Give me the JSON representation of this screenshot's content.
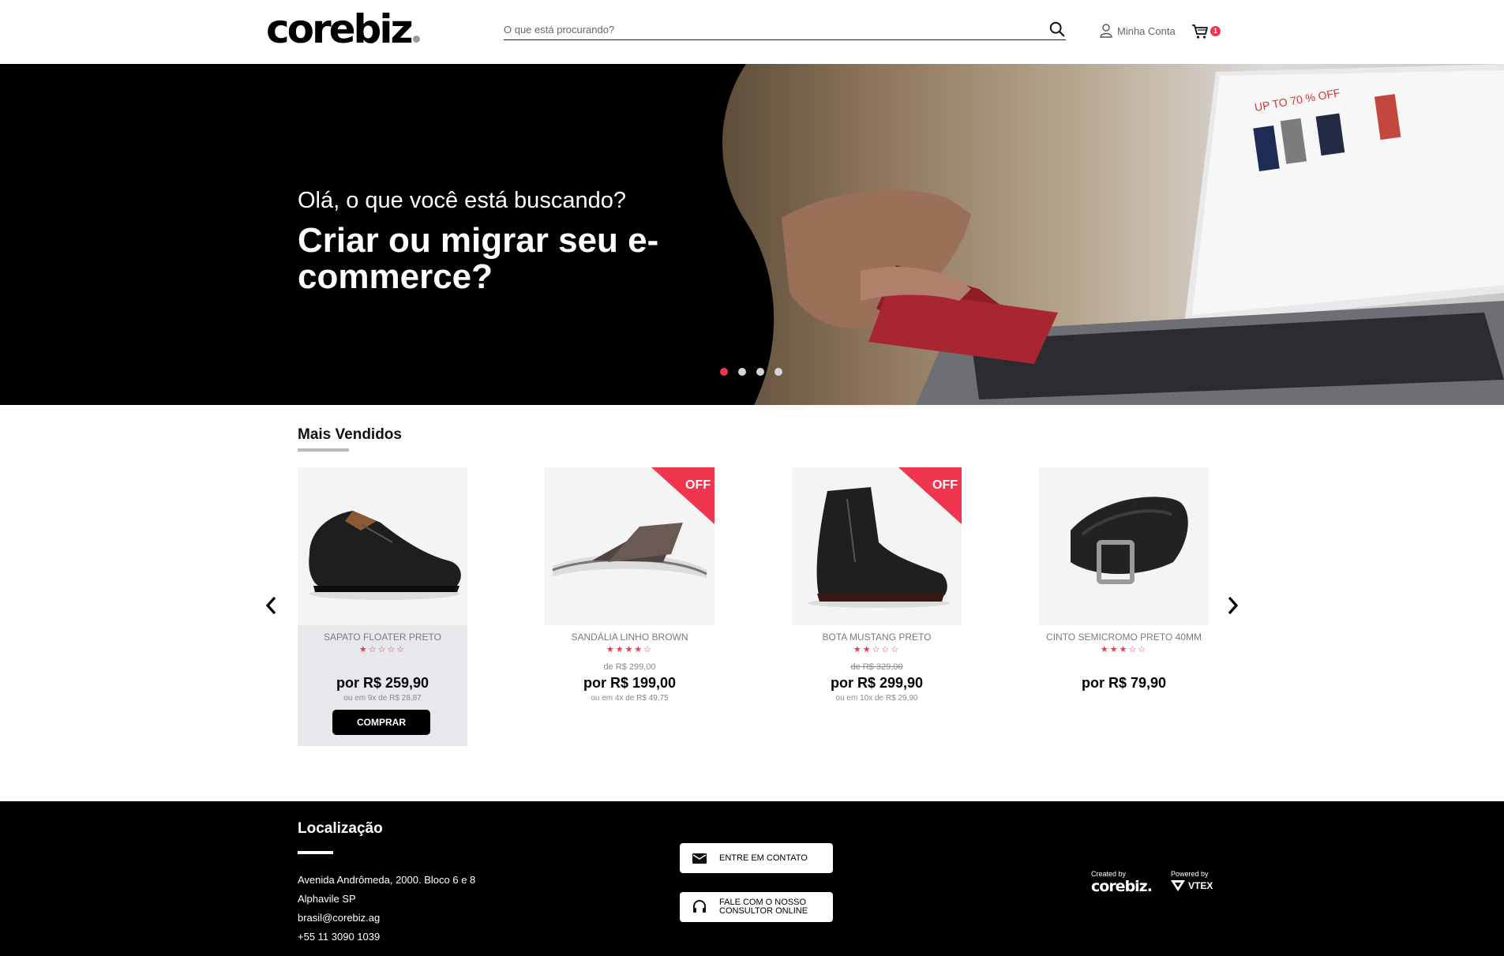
{
  "header": {
    "logo_text": "corebiz",
    "search_placeholder": "O que está procurando?",
    "account_label": "Minha Conta",
    "cart_count": "1"
  },
  "hero": {
    "subtitle": "Olá, o que você está buscando?",
    "title": "Criar ou migrar seu e-commerce?",
    "slides": 4,
    "active_slide": 1
  },
  "bestsellers": {
    "title": "Mais Vendidos",
    "off_label": "OFF",
    "buy_label": "COMPRAR",
    "products": [
      {
        "name": "SAPATO FLOATER PRETO",
        "rating": 1,
        "stars": "★☆☆☆☆",
        "list_price": "",
        "price": "por R$ 259,90",
        "installments": "ou em 9x de R$ 28,87",
        "off": false
      },
      {
        "name": "SANDÁLIA LINHO BROWN",
        "rating": 4,
        "stars": "★★★★☆",
        "list_price": "de R$ 299,00",
        "price": "por R$ 199,00",
        "installments": "ou em 4x de R$ 49,75",
        "off": true
      },
      {
        "name": "BOTA MUSTANG PRETO",
        "rating": 2,
        "stars": "★★☆☆☆",
        "list_price": "de R$ 329,00",
        "price": "por R$ 299,90",
        "installments": "ou em 10x de R$ 29,90",
        "off": true
      },
      {
        "name": "CINTO SEMICROMO PRETO 40MM",
        "rating": 3,
        "stars": "★★★☆☆",
        "list_price": "",
        "price": "por R$ 79,90",
        "installments": "",
        "off": false
      }
    ]
  },
  "footer": {
    "title": "Localização",
    "address_line1": "Avenida Andrômeda, 2000. Bloco 6 e 8",
    "address_line2": "Alphavile SP",
    "email": "brasil@corebiz.ag",
    "phone": "+55 11 3090 1039",
    "contact_button": "ENTRE EM CONTATO",
    "consultant_button_line1": "FALE COM O NOSSO",
    "consultant_button_line2": "CONSULTOR ONLINE",
    "created_by": "Created by",
    "created_brand": "corebiz.",
    "powered_by": "Powered by",
    "powered_brand": "VTEX"
  },
  "colors": {
    "accent": "#f0354f",
    "hero_bg": "#000000",
    "footer_bg": "#000000"
  }
}
